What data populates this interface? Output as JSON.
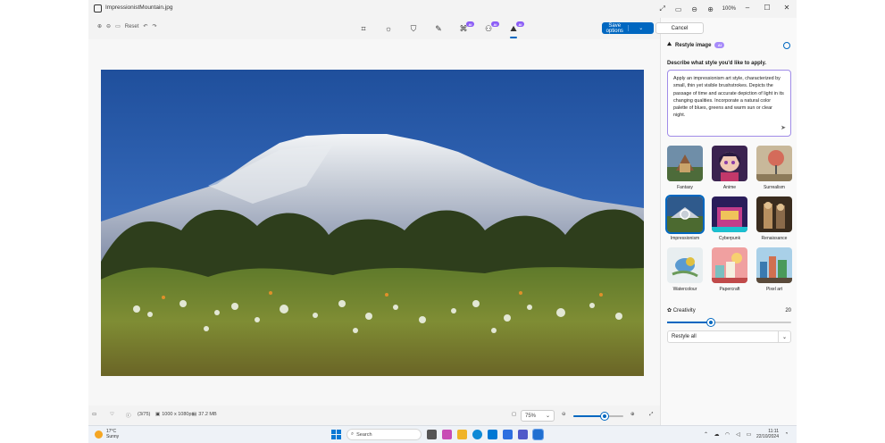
{
  "window": {
    "file_name": "ImpressionistMountain.jpg",
    "zoom_level": "100%",
    "controls": {
      "minimize": "–",
      "maximize": "☐",
      "close": "✕"
    },
    "tool_icons": [
      "expand-icon",
      "image-icon",
      "zoom-out-icon",
      "zoom-in-icon"
    ]
  },
  "toolbar": {
    "reset_label": "Reset",
    "tools": [
      {
        "name": "crop",
        "icon": "⌗",
        "ai": false
      },
      {
        "name": "adjust",
        "icon": "☼",
        "ai": false
      },
      {
        "name": "filter",
        "icon": "⛉",
        "ai": false
      },
      {
        "name": "markup",
        "icon": "✎",
        "ai": false
      },
      {
        "name": "erase",
        "icon": "⌘",
        "ai": true
      },
      {
        "name": "background",
        "icon": "⚇",
        "ai": true
      },
      {
        "name": "restyle",
        "icon": "⛰",
        "ai": true
      }
    ],
    "ai_badge": "AI"
  },
  "actions": {
    "save_label": "Save options",
    "cancel_label": "Cancel"
  },
  "panel": {
    "title": "Restyle image",
    "ai_badge": "AI",
    "prompt_label": "Describe what style you'd like to apply.",
    "prompt_text": "Apply an impressionism art style, characterized by small, thin yet visible brushstrokes. Depicts the passage of time and accurate depiction of light in its changing qualities. Incorporate a natural color palette of blues, greens and warm sun or clear night.",
    "styles": [
      {
        "label": "Fantasy",
        "selected": false
      },
      {
        "label": "Anime",
        "selected": false
      },
      {
        "label": "Surrealism",
        "selected": false
      },
      {
        "label": "Impressionism",
        "selected": true
      },
      {
        "label": "Cyberpunk",
        "selected": false
      },
      {
        "label": "Renaissance",
        "selected": false
      },
      {
        "label": "Watercolour",
        "selected": false
      },
      {
        "label": "Papercraft",
        "selected": false
      },
      {
        "label": "Pixel art",
        "selected": false
      }
    ],
    "creativity_label": "Creativity",
    "creativity_value": "20",
    "creativity_fraction": 0.35,
    "restyle_label": "Restyle all"
  },
  "status": {
    "position": "(3/75)",
    "dimensions": "1000 x 1080px",
    "file_size": "37.2 MB",
    "zoom_value": "75%",
    "zoom_fraction": 0.62
  },
  "taskbar": {
    "temperature": "17°C",
    "condition": "Sunny",
    "search_placeholder": "Search",
    "time": "11:11",
    "date": "22/10/2024"
  },
  "colors": {
    "accent": "#0067c0",
    "ai_badge": "#8b5cf6"
  }
}
